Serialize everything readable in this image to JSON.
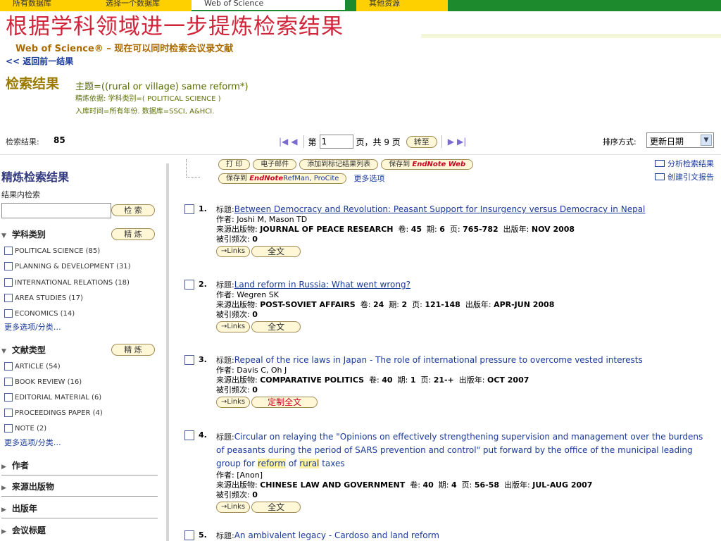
{
  "tabs": [
    "所有数据库",
    "选择一个数据库",
    "Web of Science",
    "其他资源"
  ],
  "banner": {
    "title": "根据学科领域进一步提炼检索结果",
    "wos_line": "Web of Science® – 现在可以同时检索会议录文献"
  },
  "back_link": "<< 返回前一结果",
  "results": {
    "heading": "检索结果",
    "query": "主题=((rural or village) same reform*)",
    "refine_by": "精炼依据: 学科类别=( POLITICAL SCIENCE )",
    "db_line": "入库时间=所有年份. 数据库=SSCI, A&HCI."
  },
  "resbar": {
    "count_label": "检索结果:",
    "count_value": "85",
    "page_prefix": "第",
    "page_value": "1",
    "page_suffix": "页，共 9 页",
    "goto_label": "转至",
    "sort_label": "排序方式:",
    "sort_value": "更新日期"
  },
  "sidebar": {
    "title": "精炼检索结果",
    "search_within": "结果内检索",
    "search_button": "检 索",
    "facets": [
      {
        "label": "学科类别",
        "refine": "精 炼",
        "items": [
          "POLITICAL SCIENCE (85)",
          "PLANNING & DEVELOPMENT (31)",
          "INTERNATIONAL RELATIONS (18)",
          "AREA STUDIES (17)",
          "ECONOMICS (14)"
        ],
        "more": "更多选项/分类…"
      },
      {
        "label": "文献类型",
        "refine": "精 炼",
        "items": [
          "ARTICLE (54)",
          "BOOK REVIEW (16)",
          "EDITORIAL MATERIAL (6)",
          "PROCEEDINGS PAPER (4)",
          "NOTE (2)"
        ],
        "more": "更多选项/分类…"
      }
    ],
    "collapsed": [
      "作者",
      "来源出版物",
      "出版年",
      "会议标题"
    ]
  },
  "toolbar": {
    "print": "打 印",
    "email": "电子邮件",
    "add_marked": "添加到标记结果列表",
    "save_to": "保存到",
    "endnote_web": "EndNote Web",
    "save_to2": "保存到",
    "endnote": "EndNote",
    "refman": "RefMan, ProCite",
    "more_options": "更多选项",
    "analyze": "分析检索结果",
    "citation_report": "创建引文报告"
  },
  "labels": {
    "title": "标题:",
    "author": "作者:",
    "source": "来源出版物:",
    "volume": "卷:",
    "issue": "期:",
    "pages": "页:",
    "year": "出版年:",
    "cited": "被引频次:",
    "links": "→Links"
  },
  "records": [
    {
      "num": "1.",
      "title": "Between Democracy and Revolution: Peasant Support for Insurgency versus Democracy in Nepal",
      "authors": "Joshi M, Mason TD",
      "source": "JOURNAL OF PEACE RESEARCH",
      "volume": "45",
      "issue": "6",
      "pages": "765-782",
      "year": "NOV 2008",
      "cited": "0",
      "fulltext": "全文"
    },
    {
      "num": "2.",
      "title": "Land reform in Russia: What went wrong?",
      "authors": "Wegren SK",
      "source": "POST-SOVIET AFFAIRS",
      "volume": "24",
      "issue": "2",
      "pages": "121-148",
      "year": "APR-JUN 2008",
      "cited": "0",
      "fulltext": "全文"
    },
    {
      "num": "3.",
      "title": "Repeal of the rice laws in Japan - The role of international pressure to overcome vested interests",
      "authors": "Davis C, Oh J",
      "source": "COMPARATIVE POLITICS",
      "volume": "40",
      "issue": "1",
      "pages": "21-+",
      "year": "OCT 2007",
      "cited": "0",
      "fulltext": "定制全文"
    },
    {
      "num": "4.",
      "title_a": "Circular on relaying the \"Opinions on effectively strengthening supervision and management over the burdens of peasants during the period of SARS prevention and control\" put forward by the office of the municipal leading group for ",
      "title_hl1": "reform",
      "title_b": " of ",
      "title_hl2": "rural",
      "title_c": " taxes",
      "authors": "[Anon]",
      "source": "CHINESE LAW AND GOVERNMENT",
      "volume": "40",
      "issue": "4",
      "pages": "56-58",
      "year": "JUL-AUG 2007",
      "cited": "0",
      "fulltext": "全文"
    },
    {
      "num": "5.",
      "title": "An ambivalent legacy - Cardoso and land reform"
    }
  ],
  "colors": {
    "title_red": "#d0253a",
    "tab_yellow": "#ffd000",
    "tab_green": "#1e8a2e",
    "link_blue": "#1a3a9a"
  }
}
